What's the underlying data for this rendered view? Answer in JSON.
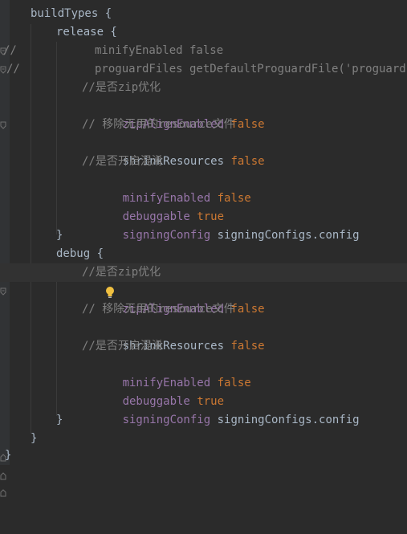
{
  "colors": {
    "background": "#2b2b2b",
    "plain": "#a9b7c6",
    "comment": "#808080",
    "property": "#9876aa",
    "keyword": "#cc7832",
    "string": "#6a8759",
    "bulb": "#f0c040"
  },
  "icons": {
    "bulb": "intention-bulb-icon",
    "fold": "fold-marker-icon"
  },
  "lines": [
    {
      "gutter": "",
      "tokens": [
        "buildTypes {"
      ]
    },
    {
      "gutter": "",
      "tokens": [
        "release {"
      ]
    },
    {
      "gutter": "//",
      "tokens": [
        "minifyEnabled false"
      ]
    },
    {
      "gutter": "//",
      "tokens": [
        "proguardFiles getDefaultProguardFile('proguard-an"
      ]
    },
    {
      "gutter": "",
      "tokens": [
        "//是否zip优化"
      ]
    },
    {
      "gutter": "",
      "tokens": [
        "zipAlignEnabled",
        " ",
        "false"
      ]
    },
    {
      "gutter": "",
      "tokens": [
        "// 移除无用的resource文件"
      ]
    },
    {
      "gutter": "",
      "tokens": [
        "shrinkResources",
        " ",
        "false"
      ]
    },
    {
      "gutter": "",
      "tokens": [
        "//是否开启混淆"
      ]
    },
    {
      "gutter": "",
      "tokens": [
        "minifyEnabled",
        " ",
        "false"
      ]
    },
    {
      "gutter": "",
      "tokens": [
        "debuggable",
        " ",
        "true"
      ]
    },
    {
      "gutter": "",
      "tokens": [
        "signingConfig",
        " signingConfigs.config"
      ]
    },
    {
      "gutter": "",
      "tokens": [
        "}"
      ]
    },
    {
      "gutter": "",
      "tokens": [
        "debug {"
      ]
    },
    {
      "gutter": "",
      "tokens": [
        "//是否zip优化"
      ]
    },
    {
      "gutter": "",
      "tokens": [
        "zipAlignEnabled",
        " ",
        "false"
      ]
    },
    {
      "gutter": "",
      "tokens": [
        "// 移除无用的resource文件"
      ]
    },
    {
      "gutter": "",
      "tokens": [
        "shrinkResources",
        " ",
        "false"
      ]
    },
    {
      "gutter": "",
      "tokens": [
        "//是否开启混淆"
      ]
    },
    {
      "gutter": "",
      "tokens": [
        "minifyEnabled",
        " ",
        "false"
      ]
    },
    {
      "gutter": "",
      "tokens": [
        "debuggable",
        " ",
        "true"
      ]
    },
    {
      "gutter": "",
      "tokens": [
        "signingConfig",
        " signingConfigs.config"
      ]
    },
    {
      "gutter": "",
      "tokens": [
        "}"
      ]
    },
    {
      "gutter": "",
      "tokens": [
        "}"
      ]
    },
    {
      "gutter": "",
      "tokens": [
        "}"
      ]
    }
  ]
}
